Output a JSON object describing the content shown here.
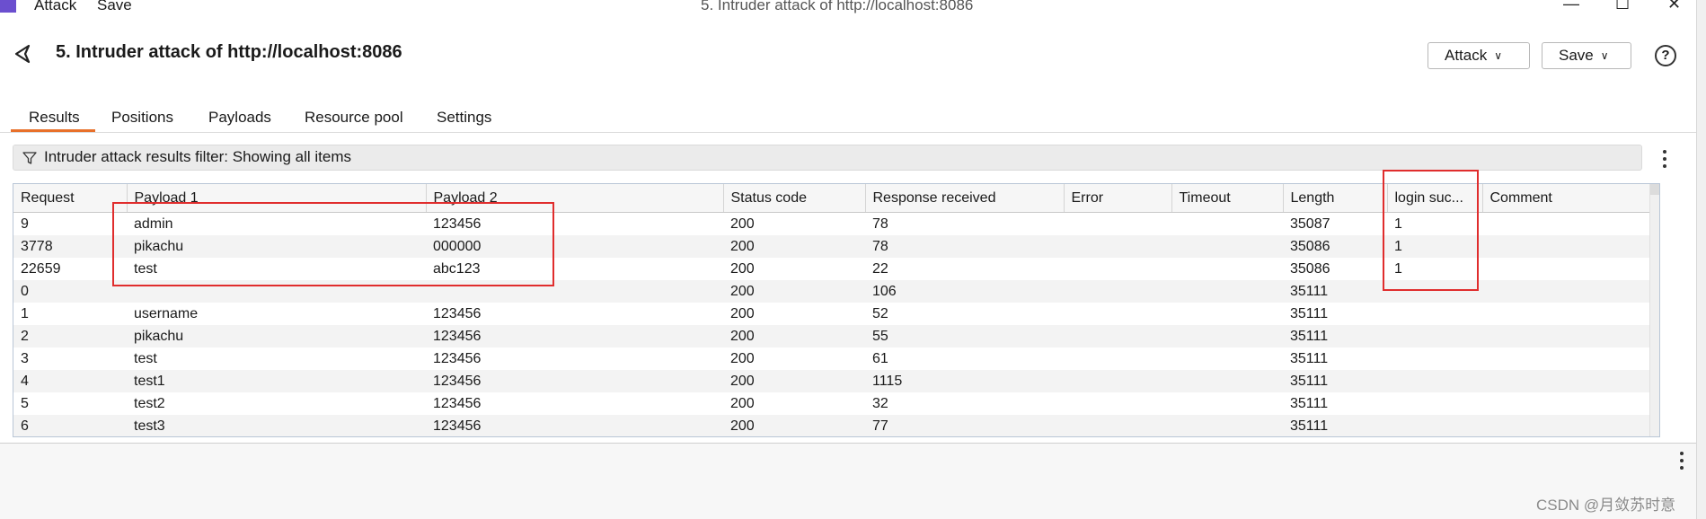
{
  "window": {
    "menu": [
      "Attack",
      "Save"
    ],
    "title": "5. Intruder attack of http://localhost:8086",
    "controls": [
      "—",
      "☐",
      "✕"
    ]
  },
  "header": {
    "title": "5. Intruder attack of http://localhost:8086",
    "attack_label": "Attack",
    "save_label": "Save",
    "help_glyph": "?"
  },
  "tabs": [
    {
      "label": "Results",
      "active": true
    },
    {
      "label": "Positions",
      "active": false
    },
    {
      "label": "Payloads",
      "active": false
    },
    {
      "label": "Resource pool",
      "active": false
    },
    {
      "label": "Settings",
      "active": false
    }
  ],
  "filter": {
    "text": "Intruder attack results filter: Showing all items"
  },
  "table": {
    "columns": [
      "Request",
      "Payload 1",
      "Payload 2",
      "Status code",
      "Response received",
      "Error",
      "Timeout",
      "Length",
      "login suc...",
      "Comment"
    ],
    "rows": [
      [
        "9",
        "admin",
        "123456",
        "200",
        "78",
        "",
        "",
        "35087",
        "1",
        ""
      ],
      [
        "3778",
        "pikachu",
        "000000",
        "200",
        "78",
        "",
        "",
        "35086",
        "1",
        ""
      ],
      [
        "22659",
        "test",
        "abc123",
        "200",
        "22",
        "",
        "",
        "35086",
        "1",
        ""
      ],
      [
        "0",
        "",
        "",
        "200",
        "106",
        "",
        "",
        "35111",
        "",
        ""
      ],
      [
        "1",
        "username",
        "123456",
        "200",
        "52",
        "",
        "",
        "35111",
        "",
        ""
      ],
      [
        "2",
        "pikachu",
        "123456",
        "200",
        "55",
        "",
        "",
        "35111",
        "",
        ""
      ],
      [
        "3",
        "test",
        "123456",
        "200",
        "61",
        "",
        "",
        "35111",
        "",
        ""
      ],
      [
        "4",
        "test1",
        "123456",
        "200",
        "1115",
        "",
        "",
        "35111",
        "",
        ""
      ],
      [
        "5",
        "test2",
        "123456",
        "200",
        "32",
        "",
        "",
        "35111",
        "",
        ""
      ],
      [
        "6",
        "test3",
        "123456",
        "200",
        "77",
        "",
        "",
        "35111",
        "",
        ""
      ]
    ]
  },
  "icons": {
    "back": "back-arrow-icon",
    "filter": "funnel-icon",
    "help": "help-circle-icon",
    "more": "kebab-menu-icon"
  },
  "colors": {
    "accent": "#e8702a",
    "highlight": "#e02d2d",
    "app_icon": "#6b4fcf"
  },
  "watermark": "CSDN @月敛苏时意"
}
